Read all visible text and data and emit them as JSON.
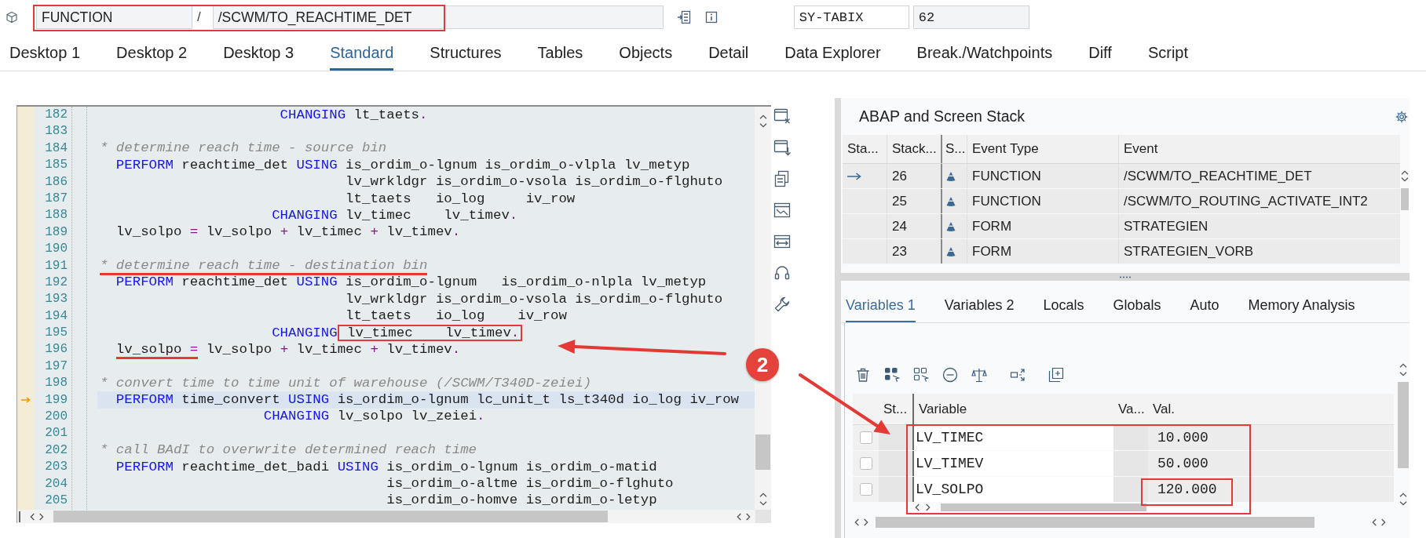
{
  "header": {
    "program_type": "FUNCTION",
    "separator": "/",
    "program_name": "/SCWM/TO_REACHTIME_DET",
    "highlighted": true,
    "variable_name": "SY-TABIX",
    "variable_value": "62"
  },
  "tabs": [
    {
      "label": "Desktop 1",
      "selected": false
    },
    {
      "label": "Desktop 2",
      "selected": false
    },
    {
      "label": "Desktop 3",
      "selected": false
    },
    {
      "label": "Standard",
      "selected": true
    },
    {
      "label": "Structures",
      "selected": false
    },
    {
      "label": "Tables",
      "selected": false
    },
    {
      "label": "Objects",
      "selected": false
    },
    {
      "label": "Detail",
      "selected": false
    },
    {
      "label": "Data Explorer",
      "selected": false
    },
    {
      "label": "Break./Watchpoints",
      "selected": false
    },
    {
      "label": "Diff",
      "selected": false
    },
    {
      "label": "Script",
      "selected": false
    }
  ],
  "editor": {
    "lines": [
      {
        "number": "182",
        "current": false,
        "segments": [
          {
            "kind": "kw",
            "text": "                      CHANGING"
          },
          {
            "kind": "text",
            "text": " lt_taets"
          },
          {
            "kind": "op",
            "text": "."
          }
        ]
      },
      {
        "number": "183",
        "current": false
      },
      {
        "number": "184",
        "current": false,
        "segments": [
          {
            "kind": "comment",
            "text": "* determine reach time - source bin"
          }
        ]
      },
      {
        "number": "185",
        "current": false,
        "segments": [
          {
            "kind": "kw",
            "text": "  PERFORM"
          },
          {
            "kind": "text",
            "text": " reachtime_det "
          },
          {
            "kind": "kw",
            "text": "USING"
          },
          {
            "kind": "text",
            "text": " is_ordim_o-lgnum is_ordim_o-vlpla lv_metyp"
          }
        ]
      },
      {
        "number": "186",
        "current": false,
        "segments": [
          {
            "kind": "text",
            "text": "                              lv_wrkldgr is_ordim_o-vsola is_ordim_o-flghuto"
          }
        ]
      },
      {
        "number": "187",
        "current": false,
        "segments": [
          {
            "kind": "text",
            "text": "                              lt_taets   io_log     iv_row"
          }
        ]
      },
      {
        "number": "188",
        "current": false,
        "segments": [
          {
            "kind": "kw",
            "text": "                     CHANGING"
          },
          {
            "kind": "text",
            "text": " lv_timec    lv_timev"
          },
          {
            "kind": "op",
            "text": "."
          }
        ]
      },
      {
        "number": "189",
        "current": false,
        "segments": [
          {
            "kind": "text",
            "text": "  lv_solpo "
          },
          {
            "kind": "op",
            "text": "="
          },
          {
            "kind": "text",
            "text": " lv_solpo "
          },
          {
            "kind": "op",
            "text": "+"
          },
          {
            "kind": "text",
            "text": " lv_timec "
          },
          {
            "kind": "op",
            "text": "+"
          },
          {
            "kind": "text",
            "text": " lv_timev"
          },
          {
            "kind": "op",
            "text": "."
          }
        ]
      },
      {
        "number": "190",
        "current": false
      },
      {
        "number": "191",
        "current": false,
        "segments": [
          {
            "kind": "underline",
            "parts": [
              {
                "kind": "comment",
                "text": "* determine reach time - destination bin"
              }
            ]
          }
        ]
      },
      {
        "number": "192",
        "current": false,
        "segments": [
          {
            "kind": "kw",
            "text": "  PERFORM"
          },
          {
            "kind": "text",
            "text": " reachtime_det "
          },
          {
            "kind": "kw",
            "text": "USING"
          },
          {
            "kind": "text",
            "text": " is_ordim_o-lgnum   is_ordim_o-nlpla lv_metyp"
          }
        ]
      },
      {
        "number": "193",
        "current": false,
        "segments": [
          {
            "kind": "text",
            "text": "                              lv_wrkldgr is_ordim_o-vsola is_ordim_o-flghuto"
          }
        ]
      },
      {
        "number": "194",
        "current": false,
        "segments": [
          {
            "kind": "text",
            "text": "                              lt_taets   io_log    iv_row"
          }
        ]
      },
      {
        "number": "195",
        "current": false,
        "segments": [
          {
            "kind": "kw",
            "text": "                     CHANGING"
          },
          {
            "kind": "box",
            "parts": [
              {
                "kind": "text",
                "text": " lv_timec    lv_timev"
              },
              {
                "kind": "op",
                "text": "."
              }
            ]
          }
        ]
      },
      {
        "number": "196",
        "current": false,
        "segments": [
          {
            "kind": "underline",
            "parts": [
              {
                "kind": "text",
                "text": "  lv_solpo "
              },
              {
                "kind": "op",
                "text": "="
              }
            ]
          },
          {
            "kind": "text",
            "text": " lv_solpo "
          },
          {
            "kind": "op",
            "text": "+"
          },
          {
            "kind": "text",
            "text": " lv_timec "
          },
          {
            "kind": "op",
            "text": "+"
          },
          {
            "kind": "text",
            "text": " lv_timev"
          },
          {
            "kind": "op",
            "text": "."
          }
        ]
      },
      {
        "number": "197",
        "current": false
      },
      {
        "number": "198",
        "current": false,
        "segments": [
          {
            "kind": "comment",
            "text": "* convert time to time unit of warehouse (/SCWM/T340D-zeiei)"
          }
        ]
      },
      {
        "number": "199",
        "current": true,
        "segments": [
          {
            "kind": "kw",
            "text": "  PERFORM"
          },
          {
            "kind": "text",
            "text": " time_convert "
          },
          {
            "kind": "kw",
            "text": "USING"
          },
          {
            "kind": "text",
            "text": " is_ordim_o-lgnum lc_unit_t ls_t340d io_log iv_row"
          }
        ]
      },
      {
        "number": "200",
        "current": false,
        "segments": [
          {
            "kind": "kw",
            "text": "                    CHANGING"
          },
          {
            "kind": "text",
            "text": " lv_solpo lv_zeiei"
          },
          {
            "kind": "op",
            "text": "."
          }
        ]
      },
      {
        "number": "201",
        "current": false
      },
      {
        "number": "202",
        "current": false,
        "segments": [
          {
            "kind": "comment",
            "text": "* call BAdI to overwrite determined reach time"
          }
        ]
      },
      {
        "number": "203",
        "current": false,
        "segments": [
          {
            "kind": "kw",
            "text": "  PERFORM"
          },
          {
            "kind": "text",
            "text": " reachtime_det_badi "
          },
          {
            "kind": "kw",
            "text": "USING"
          },
          {
            "kind": "text",
            "text": " is_ordim_o-lgnum is_ordim_o-matid"
          }
        ]
      },
      {
        "number": "204",
        "current": false,
        "segments": [
          {
            "kind": "text",
            "text": "                                   is_ordim_o-altme is_ordim_o-flghuto"
          }
        ]
      },
      {
        "number": "205",
        "current": false,
        "segments": [
          {
            "kind": "text",
            "text": "                                   is_ordim_o-homve is_ordim_o-letyp"
          }
        ]
      }
    ]
  },
  "stack": {
    "title": "ABAP and Screen Stack",
    "columns": [
      "Sta...",
      "Stack...",
      "S...",
      "Event Type",
      "Event"
    ],
    "rows": [
      {
        "current": true,
        "number": "26",
        "event_type": "FUNCTION",
        "event": "/SCWM/TO_REACHTIME_DET"
      },
      {
        "current": false,
        "number": "25",
        "event_type": "FUNCTION",
        "event": "/SCWM/TO_ROUTING_ACTIVATE_INT2"
      },
      {
        "current": false,
        "number": "24",
        "event_type": "FORM",
        "event": "STRATEGIEN"
      },
      {
        "current": false,
        "number": "23",
        "event_type": "FORM",
        "event": "STRATEGIEN_VORB"
      }
    ]
  },
  "variables": {
    "tabs": [
      {
        "label": "Variables 1",
        "selected": true
      },
      {
        "label": "Variables 2",
        "selected": false
      },
      {
        "label": "Locals",
        "selected": false
      },
      {
        "label": "Globals",
        "selected": false
      },
      {
        "label": "Auto",
        "selected": false
      },
      {
        "label": "Memory Analysis",
        "selected": false
      }
    ],
    "columns": [
      "St...",
      "Variable",
      "Va...",
      "Val."
    ],
    "rows_boxed": true,
    "rows": [
      {
        "checked": false,
        "variable": "LV_TIMEC",
        "value": "10.000",
        "value_boxed": false
      },
      {
        "checked": false,
        "variable": "LV_TIMEV",
        "value": "50.000",
        "value_boxed": false
      },
      {
        "checked": false,
        "variable": "LV_SOLPO",
        "value": "120.000",
        "value_boxed": true
      }
    ]
  },
  "annotations": {
    "badge": "2",
    "left_arrow": true,
    "diagonal_arrow": true
  }
}
